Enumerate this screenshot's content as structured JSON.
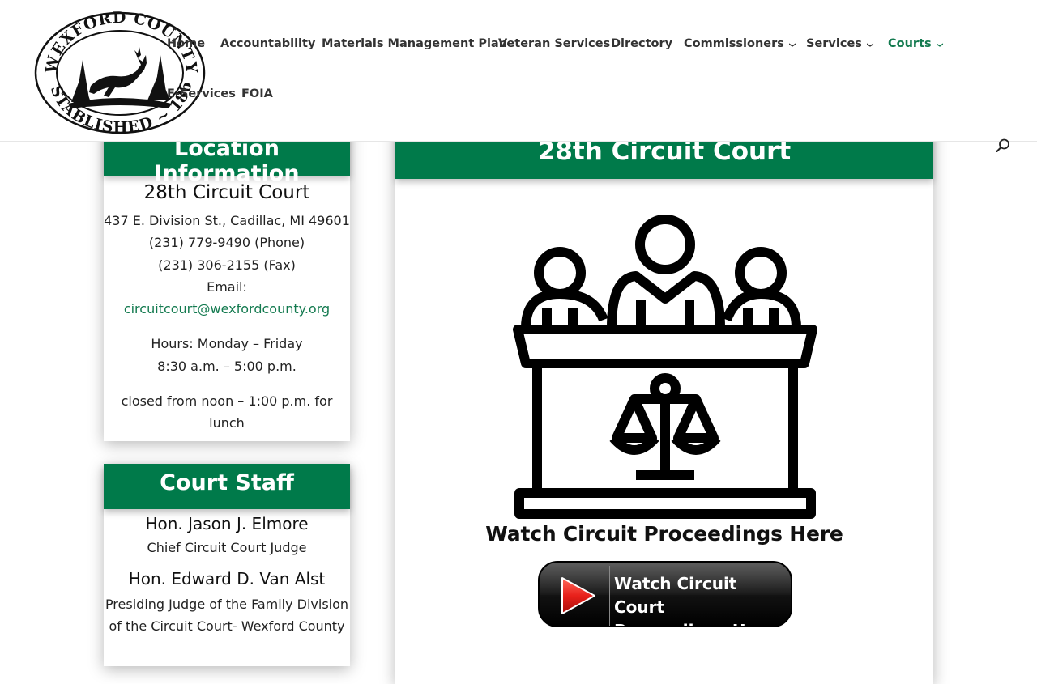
{
  "header": {
    "logo": {
      "top_text": "WEXFORD COUNTY",
      "bottom_text": "ESTABLISHED ~ 1869"
    },
    "nav": [
      {
        "label": "Home",
        "has_dropdown": false
      },
      {
        "label": "Accountability",
        "has_dropdown": false
      },
      {
        "label": "Materials Management Plan",
        "has_dropdown": false
      },
      {
        "label": "Veteran Services",
        "has_dropdown": false
      },
      {
        "label": "Directory",
        "has_dropdown": false
      },
      {
        "label": "Commissioners",
        "has_dropdown": true
      },
      {
        "label": "Services",
        "has_dropdown": true
      },
      {
        "label": "Courts",
        "has_dropdown": true,
        "active": true
      },
      {
        "label": "E-Services",
        "has_dropdown": false
      },
      {
        "label": "FOIA",
        "has_dropdown": false
      }
    ],
    "search_icon": "search-icon"
  },
  "location": {
    "title": "Location Information",
    "court_name": "28th Circuit Court",
    "address": "437 E. Division St., Cadillac, MI 49601",
    "phone": "(231) 779-9490 (Phone)",
    "fax": "(231) 306-2155 (Fax)",
    "email_label": "Email:",
    "email": "circuitcourt@wexfordcounty.org",
    "hours_line1": "Hours: Monday – Friday",
    "hours_line2": "8:30 a.m. – 5:00 p.m.",
    "closed_line1": "closed from noon – 1:00 p.m. for",
    "closed_line2": "lunch"
  },
  "staff": {
    "title": "Court Staff",
    "members": [
      {
        "name": "Hon. Jason J. Elmore",
        "title_lines": [
          "Chief Circuit Court Judge"
        ]
      },
      {
        "name": "Hon. Edward D. Van Alst",
        "title_lines": [
          "Presiding Judge of the Family Division",
          "of the Circuit Court- Wexford County"
        ]
      }
    ]
  },
  "main": {
    "title": "28th Circuit Court",
    "illustration_icon": "courtroom-judges-icon",
    "caption": "Watch Circuit Proceedings Here",
    "button": {
      "line1": "Watch Circuit Court",
      "line2": "Proceedings Here",
      "icon": "play-icon"
    }
  },
  "colors": {
    "brand_green": "#007a4a",
    "link_green": "#137a4f",
    "nav_text": "#333333",
    "play_red": "#e8201a"
  }
}
